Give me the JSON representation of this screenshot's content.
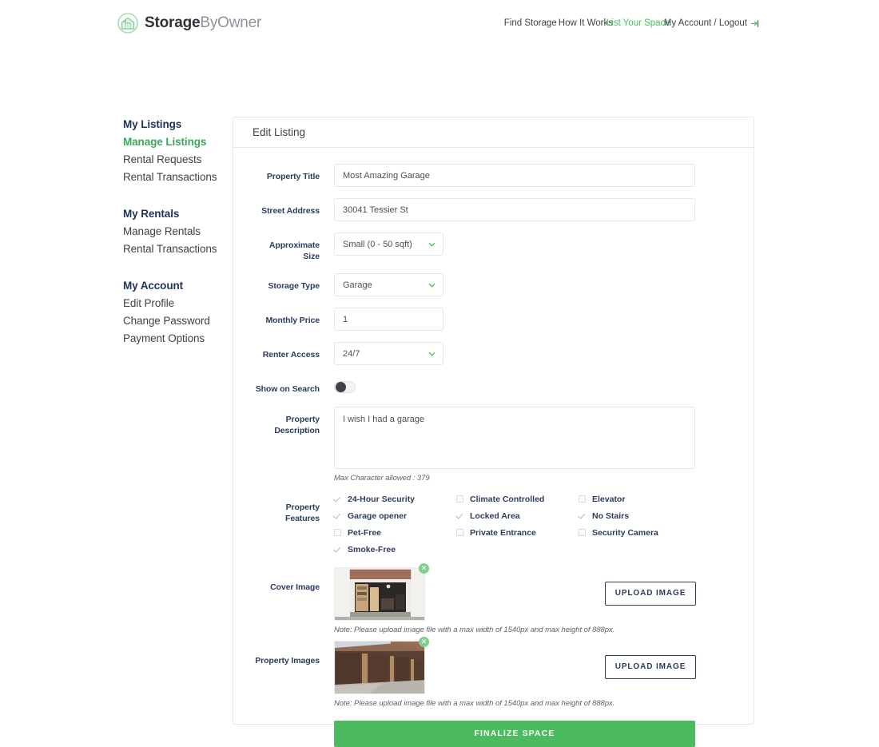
{
  "brand": {
    "name_bold": "Storage",
    "name_light": "ByOwner",
    "logo_icon": "storage-building-icon",
    "accent_green": "#4cbb5f",
    "navy": "#2b3c5c"
  },
  "topnav": {
    "items": [
      {
        "label": "Find Storage",
        "active": false
      },
      {
        "label": "How It Works",
        "active": false
      },
      {
        "label": "List Your Space",
        "active": true
      },
      {
        "label": "My Account / Logout",
        "active": false,
        "icon": "logout-arrow-icon"
      }
    ]
  },
  "sidebar": {
    "groups": [
      {
        "heading": "My Listings",
        "items": [
          {
            "label": "Manage Listings",
            "active": true
          },
          {
            "label": "Rental Requests",
            "active": false
          },
          {
            "label": "Rental Transactions",
            "active": false
          }
        ]
      },
      {
        "heading": "My Rentals",
        "items": [
          {
            "label": "Manage Rentals",
            "active": false
          },
          {
            "label": "Rental Transactions",
            "active": false
          }
        ]
      },
      {
        "heading": "My Account",
        "items": [
          {
            "label": "Edit Profile",
            "active": false
          },
          {
            "label": "Change Password",
            "active": false
          },
          {
            "label": "Payment Options",
            "active": false
          }
        ]
      }
    ]
  },
  "card": {
    "title": "Edit Listing",
    "fields": {
      "property_title": {
        "label": "Property Title",
        "value": "Most Amazing Garage"
      },
      "street_address": {
        "label": "Street Address",
        "value": "30041 Tessier St"
      },
      "approximate_size": {
        "label": "Approximate Size",
        "value": "Small (0 - 50 sqft)"
      },
      "storage_type": {
        "label": "Storage Type",
        "value": "Garage"
      },
      "monthly_price": {
        "label": "Monthly Price",
        "value": "1"
      },
      "renter_access": {
        "label": "Renter Access",
        "value": "24/7"
      },
      "show_on_search": {
        "label": "Show on Search",
        "state": "off"
      },
      "property_description": {
        "label": "Property Description",
        "value": "I wish I had a garage",
        "hint": "Max Character allowed : 379"
      }
    },
    "features": {
      "label": "Property Features",
      "items": [
        {
          "label": "24-Hour Security",
          "checked": true
        },
        {
          "label": "Climate Controlled",
          "checked": false
        },
        {
          "label": "Elevator",
          "checked": false
        },
        {
          "label": "Garage opener",
          "checked": true
        },
        {
          "label": "Locked Area",
          "checked": true
        },
        {
          "label": "No Stairs",
          "checked": true
        },
        {
          "label": "Pet-Free",
          "checked": false
        },
        {
          "label": "Private Entrance",
          "checked": false
        },
        {
          "label": "Security Camera",
          "checked": false
        },
        {
          "label": "Smoke-Free",
          "checked": true
        }
      ]
    },
    "cover_image": {
      "label": "Cover Image",
      "upload_label": "UPLOAD IMAGE",
      "delete_icon": "close-icon",
      "note": "Note: Please upload image file with a max width of 1540px and max height of 888px."
    },
    "property_images": {
      "label": "Property Images",
      "upload_label": "UPLOAD IMAGE",
      "delete_icon": "close-icon",
      "note": "Note: Please upload image file with a max width of 1540px and max height of 888px."
    },
    "finalize_label": "FINALIZE SPACE"
  }
}
